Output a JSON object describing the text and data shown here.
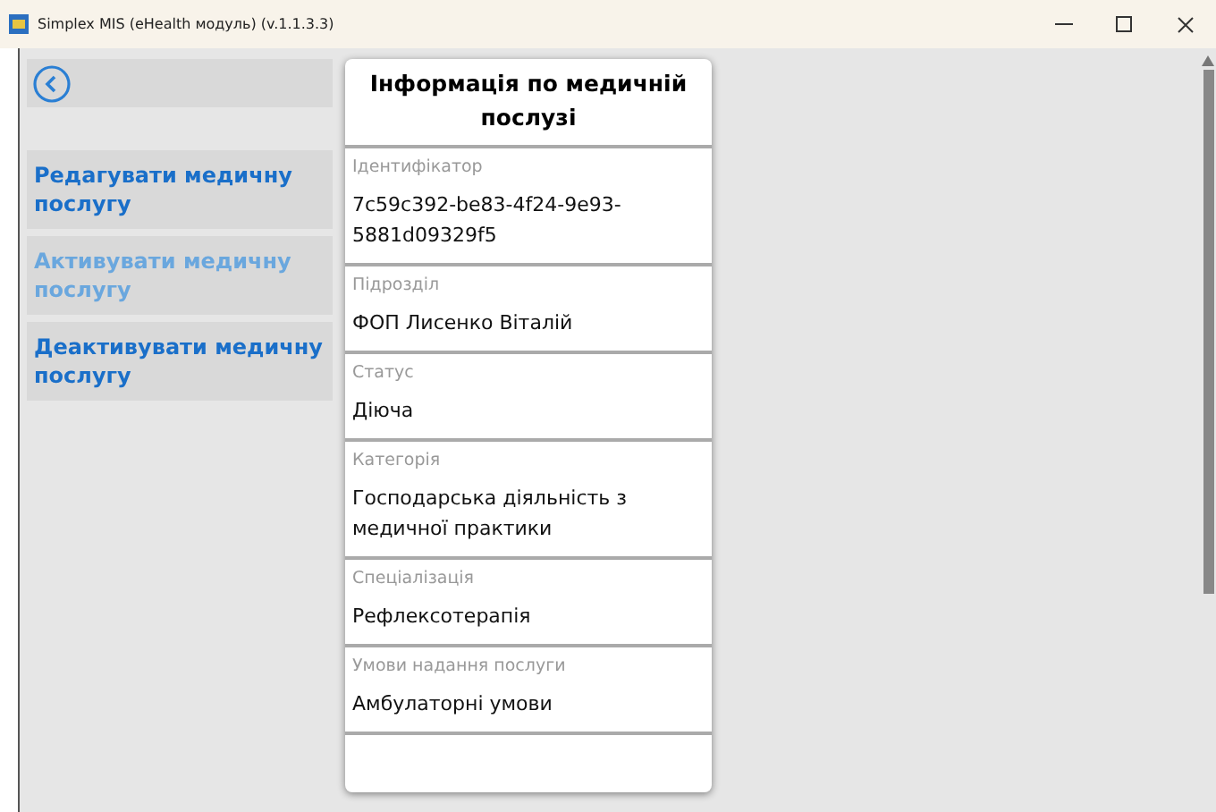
{
  "window": {
    "title": "Simplex MIS (eHealth модуль) (v.1.1.3.3)"
  },
  "actions": [
    {
      "label": "Редагувати медичну послугу",
      "disabled": false
    },
    {
      "label": "Активувати медичну послугу",
      "disabled": true
    },
    {
      "label": "Деактивувати медичну послугу",
      "disabled": false
    }
  ],
  "card": {
    "title": "Інформація по медичній послузі",
    "fields": [
      {
        "label": "Ідентифікатор",
        "value": "7c59c392-be83-4f24-9e93-5881d09329f5"
      },
      {
        "label": "Підрозділ",
        "value": "ФОП Лисенко Віталій"
      },
      {
        "label": "Статус",
        "value": "Діюча"
      },
      {
        "label": "Категорія",
        "value": "Господарська діяльність з медичної практики"
      },
      {
        "label": "Спеціалізація",
        "value": "Рефлексотерапія"
      },
      {
        "label": "Умови надання послуги",
        "value": "Амбулаторні умови"
      }
    ]
  }
}
